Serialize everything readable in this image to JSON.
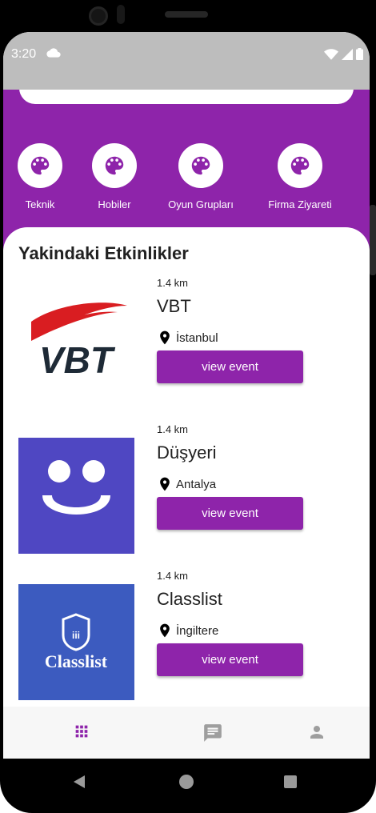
{
  "status_bar": {
    "time": "3:20"
  },
  "categories": [
    {
      "label": "Teknik",
      "icon": "palette-icon"
    },
    {
      "label": "Hobiler",
      "icon": "palette-icon"
    },
    {
      "label": "Oyun Grupları",
      "icon": "palette-icon"
    },
    {
      "label": "Firma Ziyareti",
      "icon": "palette-icon"
    }
  ],
  "section": {
    "title": "Yakindaki Etkinlikler"
  },
  "events": [
    {
      "distance": "1.4 km",
      "name": "VBT",
      "location": "İstanbul",
      "button": "view event",
      "logo": "vbt-logo"
    },
    {
      "distance": "1.4 km",
      "name": "Düşyeri",
      "location": "Antalya",
      "button": "view event",
      "logo": "dusyeri-logo"
    },
    {
      "distance": "1.4 km",
      "name": "Classlist",
      "location": "İngiltere",
      "button": "view event",
      "logo": "classlist-logo"
    }
  ],
  "bottom_nav": [
    {
      "icon": "apps-icon",
      "active": true
    },
    {
      "icon": "message-icon",
      "active": false
    },
    {
      "icon": "person-icon",
      "active": false
    }
  ],
  "logos": {
    "classlist_text": "Classlist",
    "classlist_badge": "iii",
    "vbt_text": "VBT"
  },
  "colors": {
    "primary": "#8e24aa",
    "status_bar": "#bdbdbd",
    "nav_inactive": "#9e9e9e"
  }
}
